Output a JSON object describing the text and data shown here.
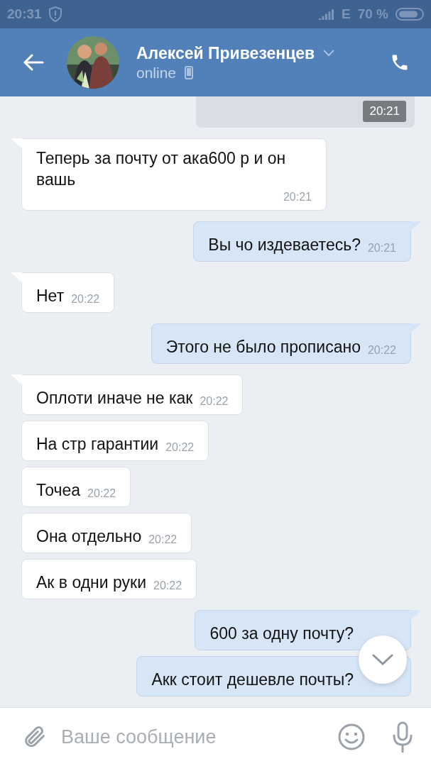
{
  "status_bar": {
    "time": "20:31",
    "network": "E",
    "battery": "70 %"
  },
  "header": {
    "name": "Алексей Привезенцев",
    "status": "online"
  },
  "messages": [
    {
      "kind": "media",
      "time": "20:21"
    },
    {
      "kind": "incoming",
      "tail": true,
      "text": "Теперь за почту от ака600 р и он вашь",
      "time": "20:21"
    },
    {
      "kind": "outgoing",
      "tail": true,
      "text": "Вы чо издеваетесь?",
      "time": "20:21"
    },
    {
      "kind": "incoming",
      "tail": true,
      "text": "Нет",
      "time": "20:22"
    },
    {
      "kind": "outgoing",
      "tail": true,
      "text": "Этого не было прописано",
      "time": "20:22"
    },
    {
      "kind": "incoming",
      "tail": true,
      "text": "Оплоти иначе не как",
      "time": "20:22"
    },
    {
      "kind": "incoming",
      "tail": false,
      "text": "На стр гарантии",
      "time": "20:22"
    },
    {
      "kind": "incoming",
      "tail": false,
      "text": "Точеа",
      "time": "20:22"
    },
    {
      "kind": "incoming",
      "tail": false,
      "text": "Она отдельно",
      "time": "20:22"
    },
    {
      "kind": "incoming",
      "tail": false,
      "text": "Ак в одни руки",
      "time": "20:22"
    },
    {
      "kind": "outgoing",
      "tail": true,
      "text": "600 за одну почту?"
    },
    {
      "kind": "outgoing",
      "tail": false,
      "text": "Акк стоит дешевле почты?"
    }
  ],
  "composer": {
    "placeholder": "Ваше сообщение"
  }
}
